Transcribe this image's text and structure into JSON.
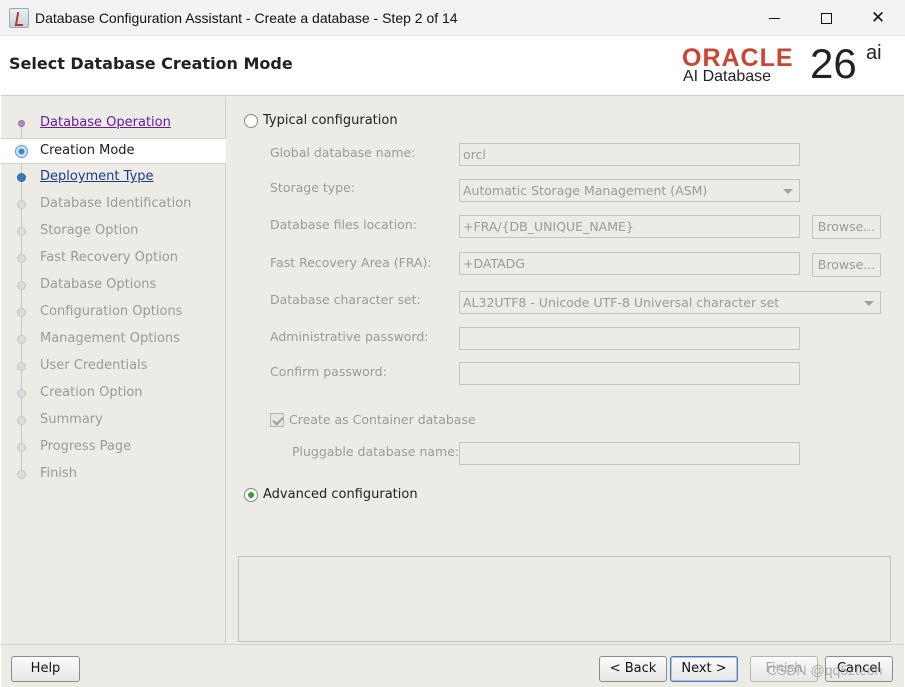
{
  "window": {
    "title": "Database Configuration Assistant - Create a database - Step 2 of 14",
    "minimize_icon": "minimize-icon",
    "maximize_icon": "maximize-icon",
    "close_glyph": "✕"
  },
  "header": {
    "title": "Select Database Creation Mode",
    "brand_oracle": "ORACLE",
    "brand_sub": "AI Database",
    "brand_version": "26",
    "brand_suffix": "ai",
    "brand_color": "#c74634"
  },
  "sidebar": {
    "steps": [
      {
        "label": "Database Operation",
        "state": "visited"
      },
      {
        "label": "Creation Mode",
        "state": "current"
      },
      {
        "label": "Deployment Type",
        "state": "next"
      },
      {
        "label": "Database Identification",
        "state": "disabled"
      },
      {
        "label": "Storage Option",
        "state": "disabled"
      },
      {
        "label": "Fast Recovery Option",
        "state": "disabled"
      },
      {
        "label": "Database Options",
        "state": "disabled"
      },
      {
        "label": "Configuration Options",
        "state": "disabled"
      },
      {
        "label": "Management Options",
        "state": "disabled"
      },
      {
        "label": "User Credentials",
        "state": "disabled"
      },
      {
        "label": "Creation Option",
        "state": "disabled"
      },
      {
        "label": "Summary",
        "state": "disabled"
      },
      {
        "label": "Progress Page",
        "state": "disabled"
      },
      {
        "label": "Finish",
        "state": "disabled"
      }
    ]
  },
  "form": {
    "typical_label": "Typical configuration",
    "typical_selected": false,
    "global_db_name_label": "Global database name:",
    "global_db_name_value": "orcl",
    "storage_type_label": "Storage type:",
    "storage_type_value": "Automatic Storage Management (ASM)",
    "db_files_location_label": "Database files location:",
    "db_files_location_value": "+FRA/{DB_UNIQUE_NAME}",
    "fra_label": "Fast Recovery Area (FRA):",
    "fra_value": "+DATADG",
    "charset_label": "Database character set:",
    "charset_value": "AL32UTF8 - Unicode UTF-8 Universal character set",
    "admin_password_label": "Administrative password:",
    "admin_password_value": "",
    "confirm_password_label": "Confirm password:",
    "confirm_password_value": "",
    "container_label": "Create as Container database",
    "container_checked": true,
    "pdb_name_label": "Pluggable database name:",
    "pdb_name_value": "",
    "browse_label": "Browse...",
    "advanced_label": "Advanced configuration",
    "advanced_selected": true
  },
  "buttons": {
    "help": "Help",
    "back": "< Back",
    "next": "Next >",
    "finish": "Finish",
    "cancel": "Cancel"
  },
  "watermark": "CSDN @qq5zteoh"
}
